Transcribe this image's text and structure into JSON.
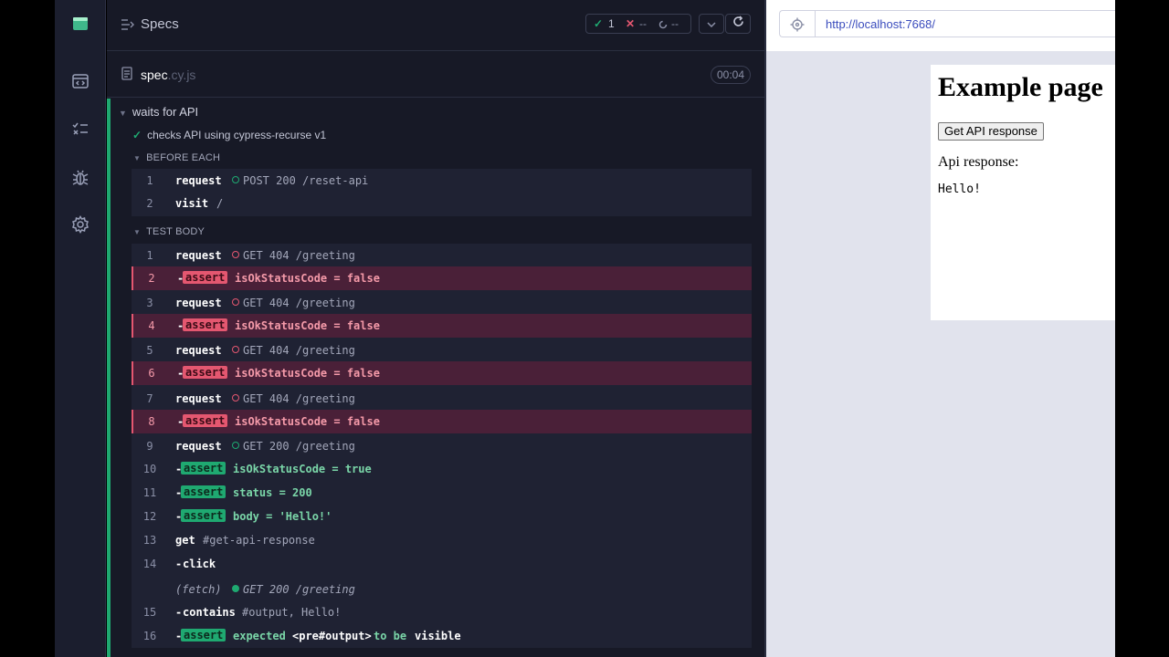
{
  "header": {
    "title": "Specs",
    "passed": "1",
    "failed": "--",
    "pending": "--"
  },
  "spec": {
    "name": "spec",
    "ext": ".cy.js",
    "duration": "00:04"
  },
  "suite": {
    "title": "waits for API"
  },
  "test": {
    "title": "checks API using cypress-recurse v1"
  },
  "before_each": {
    "label": "BEFORE EACH",
    "commands": [
      {
        "num": "1",
        "name": "request",
        "method": "POST 200 /reset-api"
      },
      {
        "num": "2",
        "name": "visit",
        "message": "/"
      }
    ]
  },
  "test_body": {
    "label": "TEST BODY",
    "commands": [
      {
        "num": "1",
        "name": "request",
        "method": "GET 404 /greeting"
      },
      {
        "num": "2",
        "badge": "assert",
        "message": "isOkStatusCode = false"
      },
      {
        "num": "3",
        "name": "request",
        "method": "GET 404 /greeting"
      },
      {
        "num": "4",
        "badge": "assert",
        "message": "isOkStatusCode = false"
      },
      {
        "num": "5",
        "name": "request",
        "method": "GET 404 /greeting"
      },
      {
        "num": "6",
        "badge": "assert",
        "message": "isOkStatusCode = false"
      },
      {
        "num": "7",
        "name": "request",
        "method": "GET 404 /greeting"
      },
      {
        "num": "8",
        "badge": "assert",
        "message": "isOkStatusCode = false"
      },
      {
        "num": "9",
        "name": "request",
        "method": "GET 200 /greeting"
      },
      {
        "num": "10",
        "badge": "assert",
        "message": "isOkStatusCode = true"
      },
      {
        "num": "11",
        "badge": "assert",
        "message": "status = 200"
      },
      {
        "num": "12",
        "badge": "assert",
        "message": "body = 'Hello!'"
      },
      {
        "num": "13",
        "name": "get",
        "message": "#get-api-response"
      },
      {
        "num": "14",
        "name": "click"
      },
      {
        "num": "",
        "name": "(fetch)",
        "method": "GET 200 /greeting"
      },
      {
        "num": "15",
        "name": "contains",
        "message": "#output, Hello!"
      },
      {
        "num": "16",
        "badge": "assert",
        "msg_a": "expected",
        "msg_b": "<pre#output>",
        "msg_c": "to be",
        "msg_d": "visible"
      }
    ]
  },
  "aut": {
    "url": "http://localhost:7668/",
    "heading": "Example page",
    "button": "Get API response",
    "label": "Api response:",
    "output": "Hello!"
  },
  "colors": {
    "pass": "#1fa971",
    "fail": "#e45770",
    "accent": "#3a4cbd"
  }
}
